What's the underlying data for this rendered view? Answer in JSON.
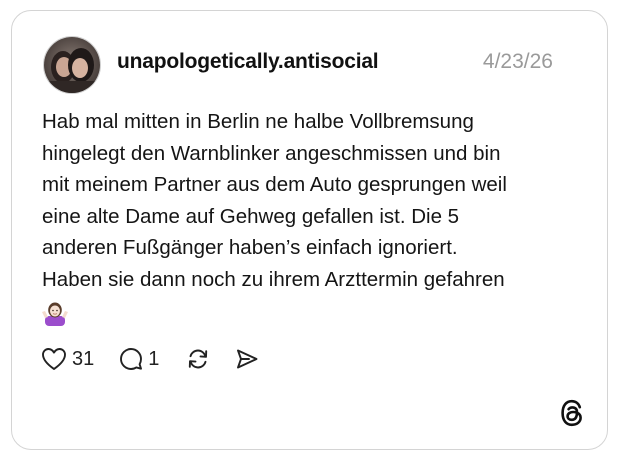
{
  "post": {
    "author": "unapologetically.antisocial",
    "date": "4/23/26",
    "text_lines": [
      "Hab mal mitten in Berlin ne halbe Vollbremsung",
      "hingelegt den Warnblinker angeschmissen und bin",
      "mit meinem Partner aus dem Auto gesprungen weil",
      "eine alte Dame auf Gehweg gefallen ist. Die 5",
      "anderen Fußgänger haben’s einfach ignoriert.",
      "Haben sie dann noch zu ihrem Arzttermin gefahren"
    ],
    "emoji": "🤷🏻‍♀️",
    "emoji_icon": "person-shrugging-icon"
  },
  "actions": {
    "likes": "31",
    "replies": "1",
    "icons": [
      "heart-icon",
      "comment-icon",
      "repost-icon",
      "share-icon"
    ]
  },
  "brand": {
    "logo": "threads-logo-icon"
  },
  "colors": {
    "text": "#151515",
    "muted": "#9a9a9a",
    "border": "#d4d4d4",
    "background": "#ffffff"
  }
}
